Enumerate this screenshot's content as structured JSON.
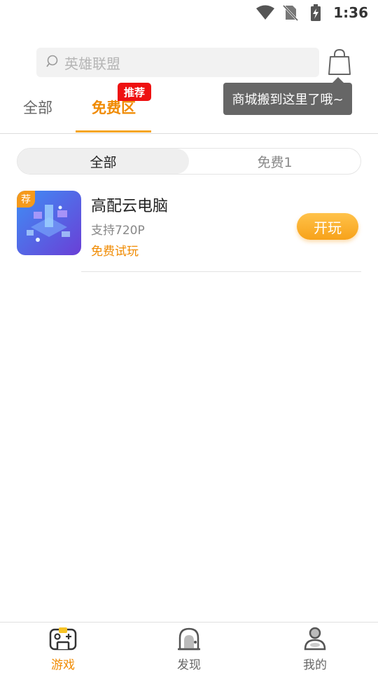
{
  "status_bar": {
    "time": "1:36",
    "icons": [
      "wifi-icon",
      "no-sim-icon",
      "battery-charging-icon"
    ]
  },
  "search": {
    "placeholder": "英雄联盟",
    "icon": "search-icon"
  },
  "header": {
    "shop_icon": "shopping-bag-icon",
    "tooltip": "商城搬到这里了哦~"
  },
  "tabs": [
    {
      "label": "全部",
      "active": false
    },
    {
      "label": "免费区",
      "active": true,
      "badge": "推荐"
    }
  ],
  "segment": [
    {
      "label": "全部",
      "active": true
    },
    {
      "label": "免费1",
      "active": false
    }
  ],
  "games": [
    {
      "badge": "荐",
      "title": "高配云电脑",
      "subtitle": "支持720P",
      "tag": "免费试玩",
      "action": "开玩"
    }
  ],
  "bottom_nav": [
    {
      "label": "游戏",
      "icon": "gamepad-icon",
      "active": true
    },
    {
      "label": "发现",
      "icon": "discover-icon",
      "active": false
    },
    {
      "label": "我的",
      "icon": "profile-icon",
      "active": false
    }
  ],
  "colors": {
    "accent": "#f08a00",
    "badge_red": "#ee1111",
    "tooltip_bg": "#666666"
  }
}
